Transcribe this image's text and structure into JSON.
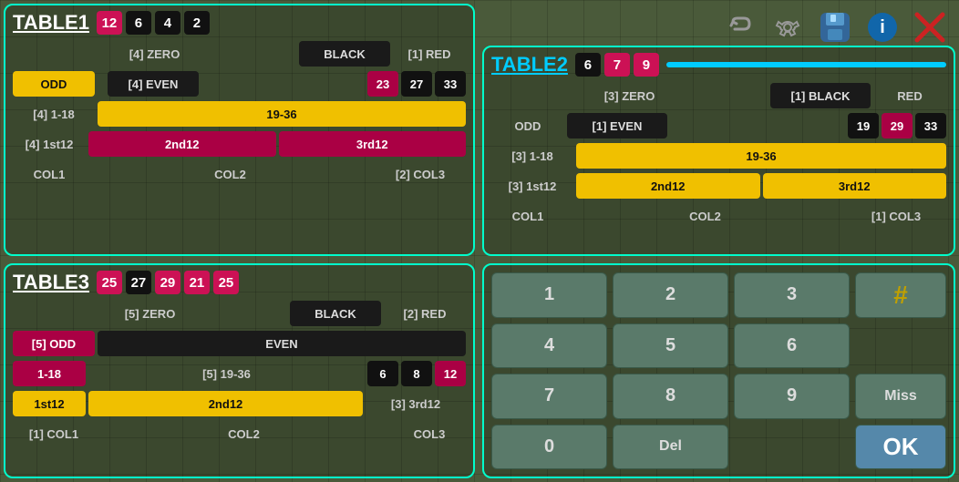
{
  "toolbar": {
    "undo_label": "↩",
    "wrench_label": "🔧",
    "save_label": "💾",
    "info_label": "ℹ",
    "close_label": "✕"
  },
  "table1": {
    "title": "TABLE1",
    "header_numbers": [
      "12",
      "6",
      "4",
      "2"
    ],
    "header_colors": [
      "red",
      "black",
      "black",
      "black"
    ],
    "rows": [
      {
        "cols": [
          "[4] ZERO",
          "BLACK",
          "[1] RED"
        ]
      },
      {
        "cols": [
          "ODD",
          "[4] EVEN",
          "23",
          "27",
          "33"
        ]
      },
      {
        "cols": [
          "[4] 1-18",
          "19-36"
        ]
      },
      {
        "cols": [
          "[4] 1st12",
          "2nd12",
          "3rd12"
        ]
      },
      {
        "cols": [
          "COL1",
          "COL2",
          "[2] COL3"
        ]
      }
    ]
  },
  "table2": {
    "title": "TABLE2",
    "header_numbers": [
      "6",
      "7",
      "9"
    ],
    "header_colors": [
      "black",
      "red",
      "red"
    ],
    "rows": [
      {
        "cols": [
          "[3] ZERO",
          "[1] BLACK",
          "RED"
        ]
      },
      {
        "cols": [
          "ODD",
          "[1] EVEN",
          "19",
          "29",
          "33"
        ]
      },
      {
        "cols": [
          "[3] 1-18",
          "19-36"
        ]
      },
      {
        "cols": [
          "[3] 1st12",
          "2nd12",
          "3rd12"
        ]
      },
      {
        "cols": [
          "COL1",
          "COL2",
          "[1] COL3"
        ]
      }
    ]
  },
  "table3": {
    "title": "TABLE3",
    "header_numbers": [
      "25",
      "27",
      "29",
      "21",
      "25"
    ],
    "header_colors": [
      "red",
      "black",
      "red",
      "red",
      "red"
    ],
    "rows": [
      {
        "cols": [
          "[5] ZERO",
          "BLACK",
          "[2] RED"
        ]
      },
      {
        "cols": [
          "[5] ODD",
          "EVEN"
        ]
      },
      {
        "cols": [
          "1-18",
          "[5] 19-36",
          "6",
          "8",
          "12"
        ]
      },
      {
        "cols": [
          "1st12",
          "2nd12",
          "[3] 3rd12"
        ]
      },
      {
        "cols": [
          "[1] COL1",
          "COL2",
          "COL3"
        ]
      }
    ]
  },
  "keypad": {
    "keys": [
      "1",
      "2",
      "3",
      "4",
      "5",
      "6",
      "7",
      "8",
      "9",
      "Miss",
      "0",
      "Del"
    ],
    "special": "#",
    "ok": "OK"
  }
}
